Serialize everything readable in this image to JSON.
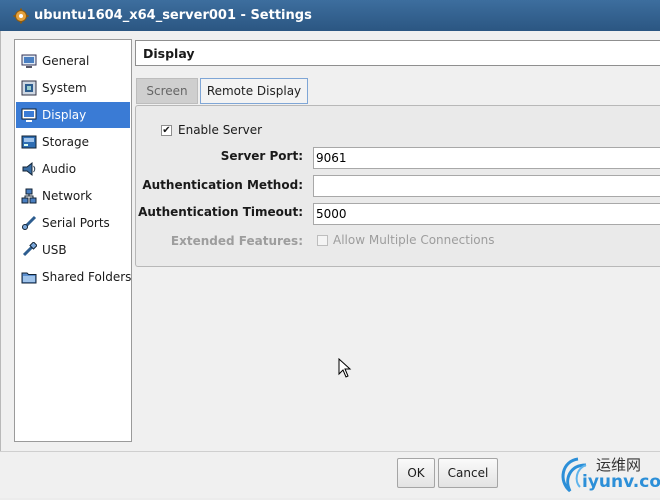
{
  "window": {
    "title": "ubuntu1604_x64_server001 - Settings"
  },
  "sidebar": {
    "items": [
      {
        "label": "General",
        "icon": "general-icon"
      },
      {
        "label": "System",
        "icon": "system-icon"
      },
      {
        "label": "Display",
        "icon": "display-icon",
        "selected": true
      },
      {
        "label": "Storage",
        "icon": "storage-icon"
      },
      {
        "label": "Audio",
        "icon": "audio-icon"
      },
      {
        "label": "Network",
        "icon": "network-icon"
      },
      {
        "label": "Serial Ports",
        "icon": "serial-ports-icon"
      },
      {
        "label": "USB",
        "icon": "usb-icon"
      },
      {
        "label": "Shared Folders",
        "icon": "shared-folders-icon"
      }
    ]
  },
  "page": {
    "title": "Display"
  },
  "tabs": [
    {
      "label": "Screen",
      "active": false
    },
    {
      "label": "Remote Display",
      "active": true
    }
  ],
  "remote_display": {
    "enable_server_label": "Enable Server",
    "enable_server_checked": true,
    "server_port_label": "Server Port:",
    "server_port_value": "9061",
    "auth_method_label": "Authentication Method:",
    "auth_method_value": "",
    "auth_timeout_label": "Authentication Timeout:",
    "auth_timeout_value": "5000",
    "extended_features_label": "Extended Features:",
    "allow_multiple_label": "Allow Multiple Connections",
    "allow_multiple_checked": false
  },
  "buttons": {
    "ok": "OK",
    "cancel": "Cancel"
  },
  "watermark": {
    "line1": "运维网",
    "line2": "iyunv.com"
  },
  "colors": {
    "accent": "#3a7bd5",
    "titlebar": "#2b5682"
  }
}
